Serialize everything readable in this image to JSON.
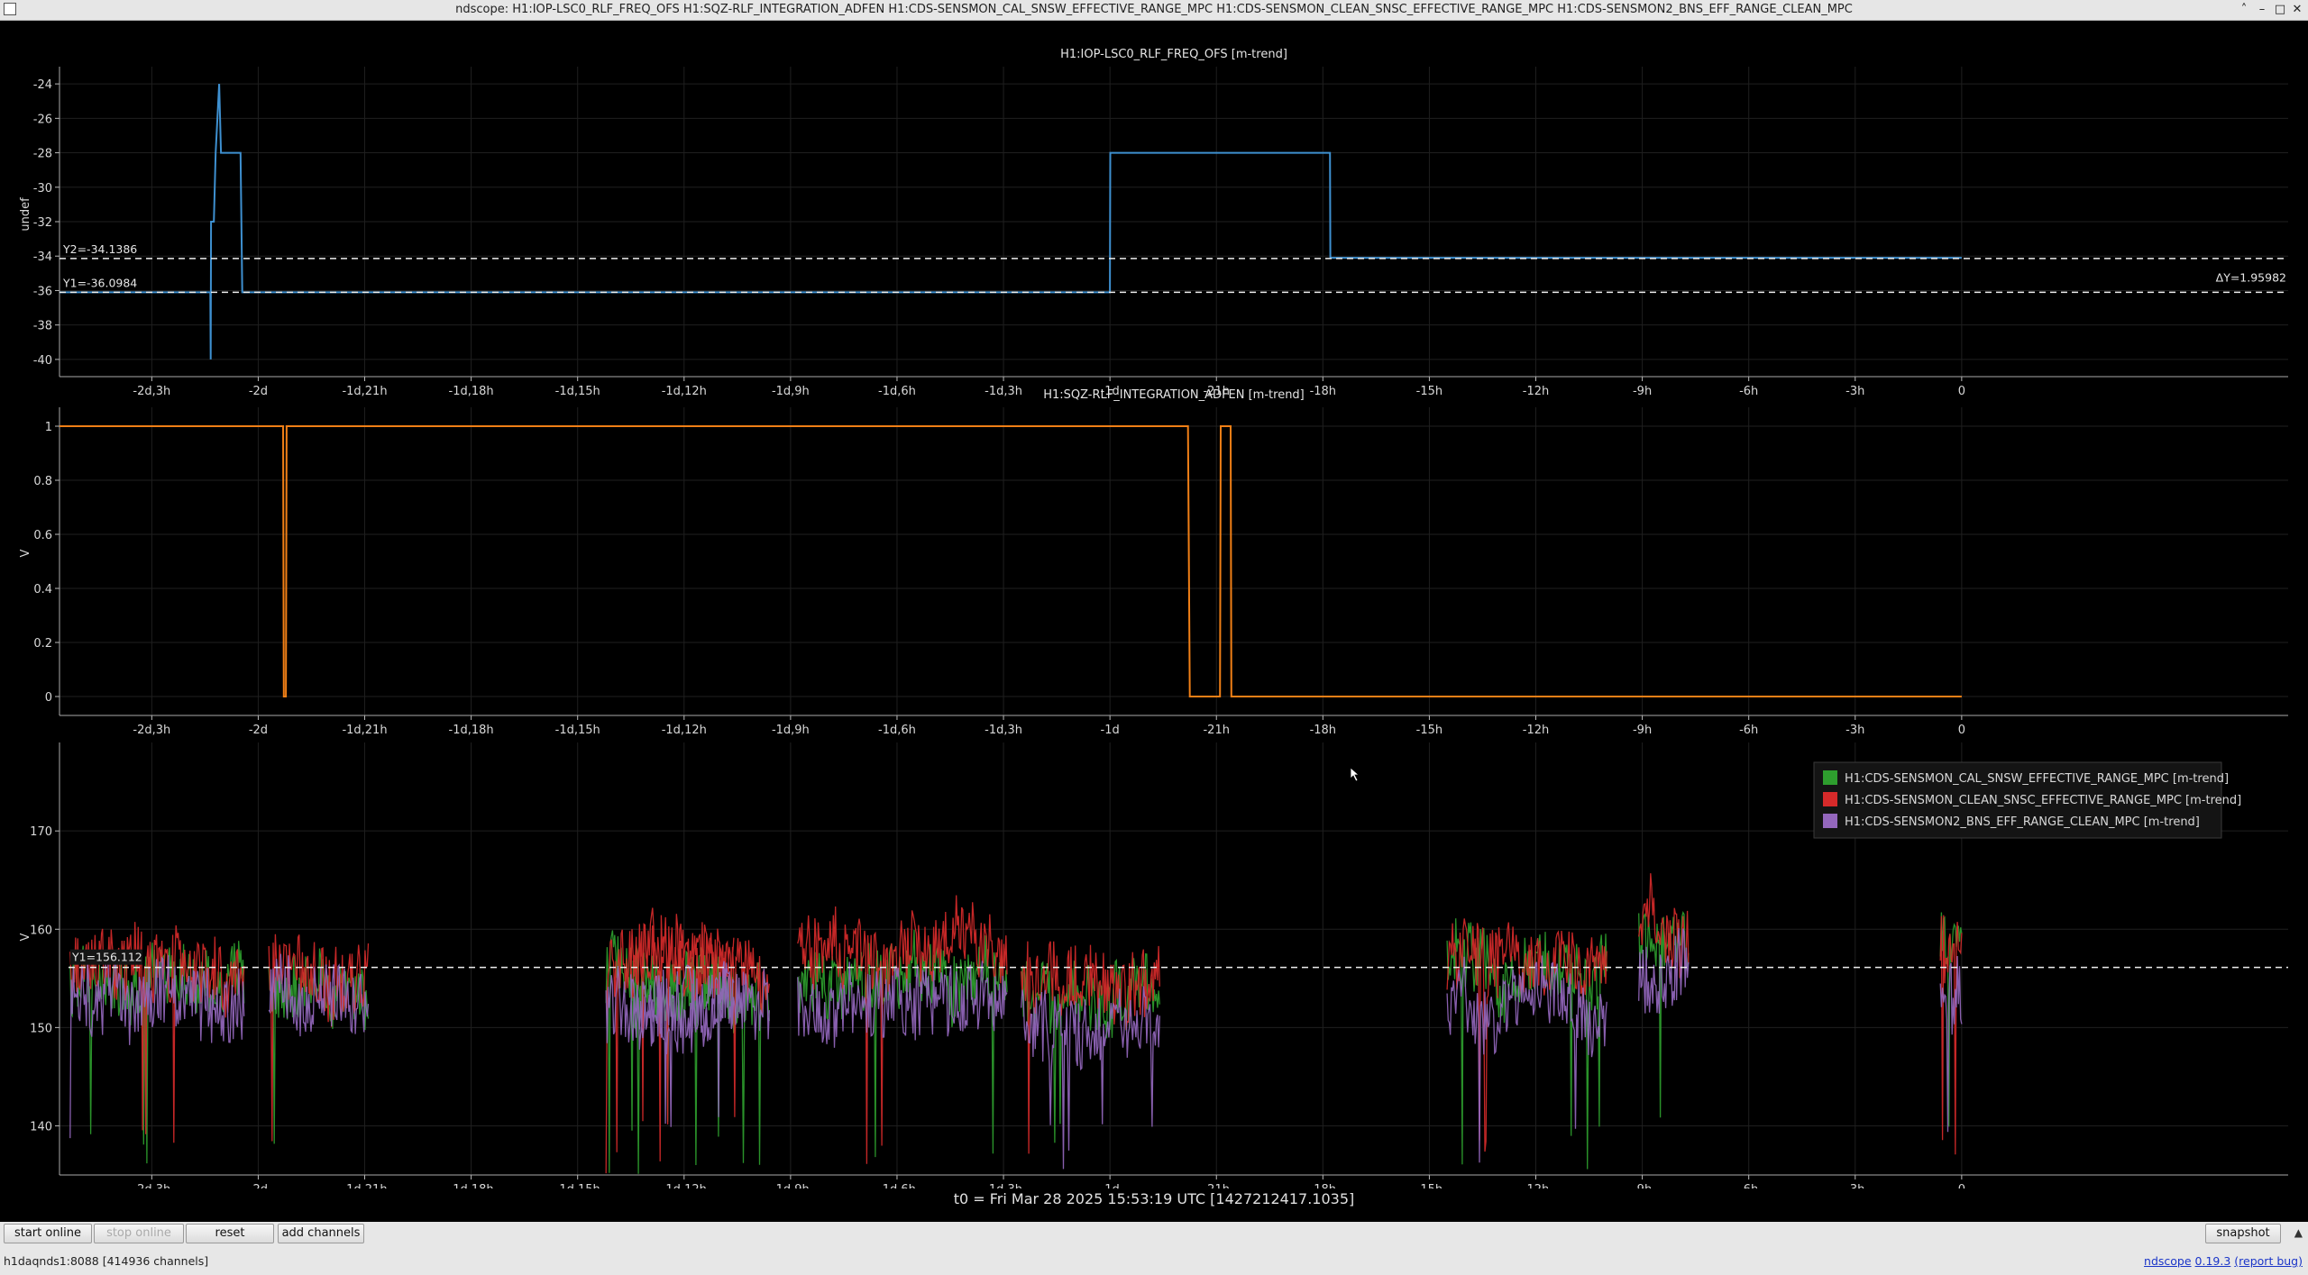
{
  "window": {
    "title": "ndscope: H1:IOP-LSC0_RLF_FREQ_OFS H1:SQZ-RLF_INTEGRATION_ADFEN H1:CDS-SENSMON_CAL_SNSW_EFFECTIVE_RANGE_MPC H1:CDS-SENSMON_CLEAN_SNSC_EFFECTIVE_RANGE_MPC H1:CDS-SENSMON2_BNS_EFF_RANGE_CLEAN_MPC",
    "min_icon": "–",
    "max_icon": "□",
    "close_icon": "✕",
    "shade_icon": "˄"
  },
  "time_ticks": [
    "-2d,3h",
    "-2d",
    "-1d,21h",
    "-1d,18h",
    "-1d,15h",
    "-1d,12h",
    "-1d,9h",
    "-1d,6h",
    "-1d,3h",
    "-1d",
    "-21h",
    "-18h",
    "-15h",
    "-12h",
    "-9h",
    "-6h",
    "-3h",
    "0"
  ],
  "plots": [
    {
      "title": "H1:IOP-LSC0_RLF_FREQ_OFS [m-trend]",
      "ylabel": "undef",
      "yticks": [
        "-24",
        "-26",
        "-28",
        "-30",
        "-32",
        "-34",
        "-36",
        "-38",
        "-40"
      ],
      "cursors": {
        "y1": "Y1=-36.0984",
        "y2": "Y2=-34.1386",
        "dy": "ΔY=1.95982"
      }
    },
    {
      "title": "H1:SQZ-RLF_INTEGRATION_ADFEN [m-trend]",
      "ylabel": "V",
      "yticks": [
        "1",
        "0.8",
        "0.6",
        "0.4",
        "0.2",
        "0"
      ]
    },
    {
      "title": "",
      "ylabel": "V",
      "yticks": [
        "170",
        "160",
        "150",
        "140"
      ],
      "cursors": {
        "y1": "Y1=156.112"
      },
      "legend": [
        {
          "label": "H1:CDS-SENSMON_CAL_SNSW_EFFECTIVE_RANGE_MPC [m-trend]",
          "color": "#2e9e2e"
        },
        {
          "label": "H1:CDS-SENSMON_CLEAN_SNSC_EFFECTIVE_RANGE_MPC [m-trend]",
          "color": "#d62a2a"
        },
        {
          "label": "H1:CDS-SENSMON2_BNS_EFF_RANGE_CLEAN_MPC [m-trend]",
          "color": "#9467bd"
        }
      ]
    }
  ],
  "chart_data": [
    {
      "type": "line",
      "title": "H1:IOP-LSC0_RLF_FREQ_OFS [m-trend]",
      "ylabel": "undef",
      "x_unit": "hours",
      "xlim": [
        -53.6,
        9.2
      ],
      "ylim": [
        -41,
        -23
      ],
      "series": [
        {
          "name": "H1:IOP-LSC0_RLF_FREQ_OFS [m-trend]",
          "color": "#3e90d0",
          "x": [
            -53.6,
            -49.4,
            -49.35,
            -49.34,
            -49.33,
            -49.25,
            -49.2,
            -49.1,
            -49.05,
            -48.85,
            -48.5,
            -48.45,
            -48.44,
            -36.0,
            -24.0,
            -23.99,
            -17.8,
            -17.79,
            0
          ],
          "y": [
            -36.1,
            -36.1,
            -36.1,
            -40,
            -32,
            -32,
            -28,
            -24,
            -28,
            -28,
            -28,
            -36.1,
            -36.1,
            -36.1,
            -36.1,
            -28,
            -28,
            -34.1,
            -34.1
          ]
        }
      ],
      "cursors": {
        "y1": -36.0984,
        "y2": -34.1386,
        "dy": 1.95982
      }
    },
    {
      "type": "line",
      "title": "H1:SQZ-RLF_INTEGRATION_ADFEN [m-trend]",
      "ylabel": "V",
      "x_unit": "hours",
      "xlim": [
        -53.6,
        9.2
      ],
      "ylim": [
        -0.07,
        1.07
      ],
      "series": [
        {
          "name": "H1:SQZ-RLF_INTEGRATION_ADFEN [m-trend]",
          "color": "#f07f16",
          "x": [
            -53.6,
            -47.3,
            -47.28,
            -47.22,
            -47.2,
            -21.8,
            -21.75,
            -20.9,
            -20.88,
            -20.6,
            -20.58,
            0
          ],
          "y": [
            1,
            1,
            0,
            0,
            1,
            1,
            0,
            0,
            1,
            1,
            0,
            0
          ]
        }
      ]
    },
    {
      "type": "line",
      "title": "",
      "ylabel": "V",
      "x_unit": "hours",
      "xlim": [
        -53.6,
        9.2
      ],
      "ylim": [
        135,
        179
      ],
      "series": [
        {
          "name": "H1:CDS-SENSMON_CAL_SNSW_EFFECTIVE_RANGE_MPC [m-trend]",
          "color": "#2e9e2e",
          "segments": [
            [
              -53.3,
              -48.4,
              154
            ],
            [
              -47.7,
              -44.9,
              154
            ],
            [
              -38.2,
              -34.6,
              155
            ],
            [
              -37.5,
              -33.6,
              154
            ],
            [
              -32.8,
              -26.9,
              155
            ],
            [
              -26.5,
              -22.6,
              153
            ],
            [
              -14.5,
              -10.0,
              156
            ],
            [
              -9.1,
              -7.7,
              158
            ],
            [
              -0.6,
              0,
              159
            ]
          ]
        },
        {
          "name": "H1:CDS-SENSMON_CLEAN_SNSC_EFFECTIVE_RANGE_MPC [m-trend]",
          "color": "#d62a2a",
          "segments": [
            [
              -53.3,
              -48.4,
              156
            ],
            [
              -47.7,
              -44.9,
              156
            ],
            [
              -38.2,
              -34.6,
              157
            ],
            [
              -37.5,
              -33.6,
              156
            ],
            [
              -32.8,
              -26.9,
              158
            ],
            [
              -26.5,
              -22.6,
              155
            ],
            [
              -14.5,
              -10.0,
              157
            ],
            [
              -9.1,
              -7.7,
              160
            ],
            [
              -0.6,
              0,
              158
            ]
          ]
        },
        {
          "name": "H1:CDS-SENSMON2_BNS_EFF_RANGE_CLEAN_MPC [m-trend]",
          "color": "#9467bd",
          "segments": [
            [
              -53.3,
              -48.4,
              153
            ],
            [
              -47.7,
              -44.9,
              152
            ],
            [
              -38.2,
              -34.6,
              152
            ],
            [
              -37.5,
              -33.6,
              152
            ],
            [
              -32.8,
              -26.9,
              153
            ],
            [
              -26.5,
              -22.6,
              150
            ],
            [
              -14.5,
              -10.0,
              152
            ],
            [
              -9.1,
              -7.7,
              155
            ],
            [
              -0.6,
              0,
              153
            ]
          ]
        }
      ],
      "cursors": {
        "y1": 156.112
      }
    }
  ],
  "footer": {
    "t0": "t0 = Fri Mar 28 2025 15:53:19 UTC [1427212417.1035]",
    "buttons": {
      "start_online": "start online",
      "stop_online": "stop online",
      "reset": "reset",
      "add_channels": "add channels",
      "snapshot": "snapshot"
    },
    "status": "h1daqnds1:8088  [414936 channels]",
    "version_prefix": "ndscope",
    "version": "0.19.3",
    "report_bug": "(report bug)"
  }
}
